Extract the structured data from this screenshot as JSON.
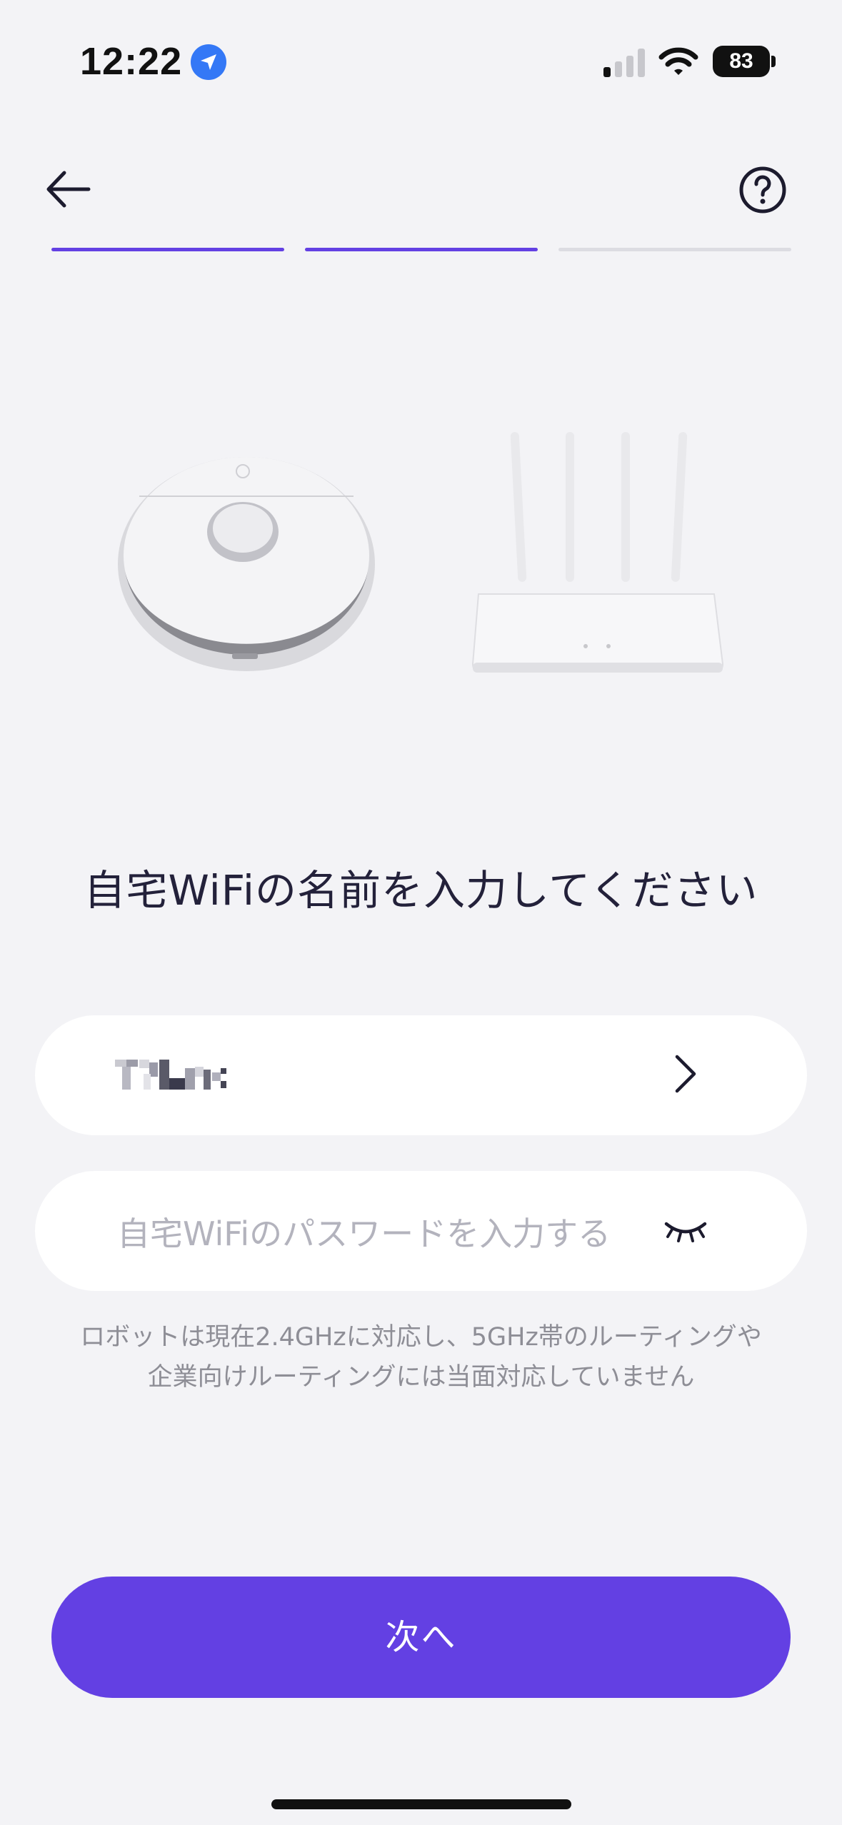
{
  "status_bar": {
    "time": "12:22",
    "battery": "83"
  },
  "header": {
    "back_icon": "arrow-left-icon",
    "help_icon": "question-circle-icon"
  },
  "progress": {
    "total_steps": 3,
    "completed_steps": 2,
    "active_color": "#6340e3",
    "inactive_color": "#dcdce2"
  },
  "main": {
    "title": "自宅WiFiの名前を入力してください",
    "wifi_name_field": {
      "value": "",
      "icon": "chevron-right-icon"
    },
    "password_field": {
      "placeholder": "自宅WiFiのパスワードを入力する",
      "icon": "eye-closed-icon"
    },
    "note": "ロボットは現在2.4GHzに対応し、5GHz帯のルーティングや\n企業向けルーティングには当面対応していません"
  },
  "footer": {
    "next_label": "次へ",
    "accent_color": "#6340e3"
  }
}
